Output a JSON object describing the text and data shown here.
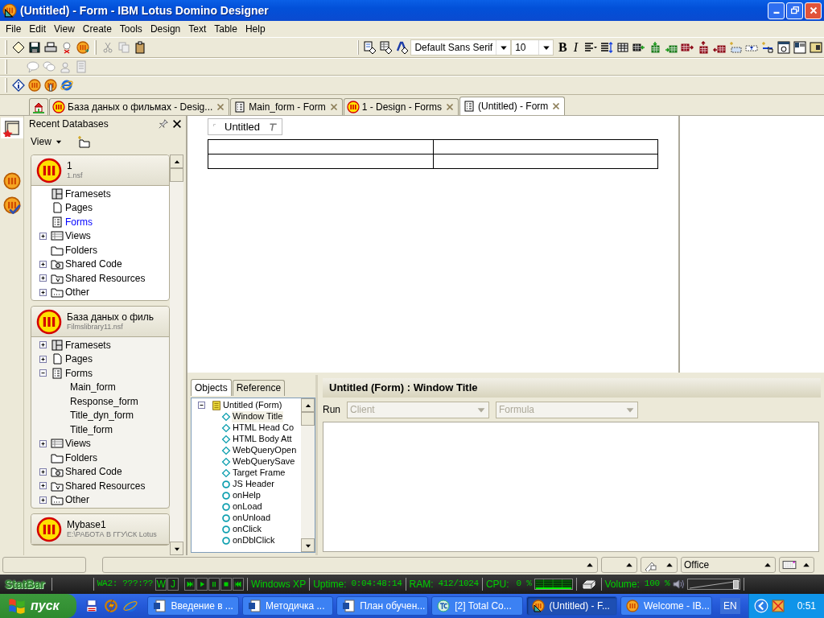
{
  "window": {
    "title": "(Untitled) - Form - IBM Lotus Domino Designer"
  },
  "menu": [
    "File",
    "Edit",
    "View",
    "Create",
    "Tools",
    "Design",
    "Text",
    "Table",
    "Help"
  ],
  "format_toolbar": {
    "font": "Default Sans Serif",
    "size": "10",
    "bold": "B",
    "italic": "I"
  },
  "tabs": [
    {
      "kind": "home",
      "selected": false
    },
    {
      "kind": "database",
      "label": "База даных о фильмах - Desig...",
      "selected": false
    },
    {
      "kind": "form",
      "label": "Main_form - Form",
      "selected": false
    },
    {
      "kind": "database",
      "label": "1 - Design - Forms",
      "selected": false
    },
    {
      "kind": "form",
      "label": "(Untitled) - Form",
      "selected": true
    }
  ],
  "sidebar": {
    "title": "Recent Databases",
    "view_menu": "View",
    "databases": [
      {
        "title": "1",
        "file": "1.nsf",
        "items": [
          {
            "kind": "frameset",
            "label": "Framesets",
            "selected": false
          },
          {
            "kind": "page",
            "label": "Pages",
            "selected": false
          },
          {
            "kind": "form",
            "label": "Forms",
            "selected": true
          },
          {
            "kind": "view",
            "label": "Views",
            "selected": false,
            "expanded": false
          },
          {
            "kind": "folder",
            "label": "Folders",
            "selected": false
          },
          {
            "kind": "shared-code",
            "label": "Shared Code",
            "selected": false,
            "expanded": false
          },
          {
            "kind": "shared-resources",
            "label": "Shared Resources",
            "selected": false,
            "expanded": false
          },
          {
            "kind": "other",
            "label": "Other",
            "selected": false,
            "expanded": false
          }
        ]
      },
      {
        "title": "База даных о филь",
        "file": "Filmslibrary11.nsf",
        "items": [
          {
            "kind": "frameset",
            "label": "Framesets",
            "selected": false,
            "expanded": false
          },
          {
            "kind": "page",
            "label": "Pages",
            "selected": false,
            "expanded": false
          },
          {
            "kind": "form",
            "label": "Forms",
            "selected": false,
            "expanded": true,
            "children": [
              {
                "label": "Main_form",
                "selected": false
              },
              {
                "label": "Response_form",
                "selected": false
              },
              {
                "label": "Title_dyn_form",
                "selected": false
              },
              {
                "label": "Title_form",
                "selected": false
              }
            ]
          },
          {
            "kind": "view",
            "label": "Views",
            "selected": false,
            "expanded": false
          },
          {
            "kind": "folder",
            "label": "Folders",
            "selected": false
          },
          {
            "kind": "shared-code",
            "label": "Shared Code",
            "selected": false,
            "expanded": false
          },
          {
            "kind": "shared-resources",
            "label": "Shared Resources",
            "selected": false,
            "expanded": false
          },
          {
            "kind": "other",
            "label": "Other",
            "selected": false,
            "expanded": false
          }
        ]
      },
      {
        "title": "Mybase1",
        "file": "E:\\РАБОТА В ГГУ\\СК Lotus"
      }
    ]
  },
  "form_canvas": {
    "title": "Untitled",
    "table": [
      {
        "cells": [
          {
            "kind": "empty"
          },
          {
            "kind": "empty"
          }
        ]
      },
      {
        "cells": [
          {
            "kind": "empty"
          },
          {
            "kind": "empty"
          }
        ]
      }
    ]
  },
  "objects_panel": {
    "tabs": [
      {
        "label": "Objects",
        "selected": true
      },
      {
        "label": "Reference",
        "selected": false
      }
    ],
    "tree": {
      "label": "Untitled (Form)",
      "expanded": true,
      "children": [
        {
          "kind": "event",
          "label": "Window Title",
          "selected": true
        },
        {
          "kind": "event",
          "label": "HTML Head Co",
          "selected": false
        },
        {
          "kind": "event",
          "label": "HTML Body Att",
          "selected": false
        },
        {
          "kind": "event",
          "label": "WebQueryOpen",
          "selected": false
        },
        {
          "kind": "event",
          "label": "WebQuerySave",
          "selected": false
        },
        {
          "kind": "event",
          "label": "Target Frame",
          "selected": false
        },
        {
          "kind": "script",
          "label": "JS Header",
          "selected": false
        },
        {
          "kind": "script",
          "label": "onHelp",
          "selected": false
        },
        {
          "kind": "script",
          "label": "onLoad",
          "selected": false
        },
        {
          "kind": "script",
          "label": "onUnload",
          "selected": false
        },
        {
          "kind": "script",
          "label": "onClick",
          "selected": false
        },
        {
          "kind": "script",
          "label": "onDblClick",
          "selected": false
        }
      ]
    }
  },
  "script_pane": {
    "title": "Untitled (Form) : Window Title",
    "run_label": "Run",
    "selects": [
      {
        "value": "Client",
        "disabled": true
      },
      {
        "value": "Formula",
        "disabled": true
      }
    ]
  },
  "status_bar": {
    "fields": [
      {
        "kind": "empty"
      },
      {
        "kind": "wide"
      },
      {
        "kind": "small"
      },
      {
        "kind": "icon"
      },
      {
        "kind": "text",
        "value": "Office"
      },
      {
        "kind": "keyboard"
      }
    ]
  },
  "statbar": {
    "logo": "StatBar",
    "winamp": "WA2: ???:??",
    "buttons": [
      "W",
      "J"
    ],
    "os": "Windows XP",
    "uptime_label": "Uptime:",
    "uptime": "0:04:48:14",
    "ram_label": "RAM:",
    "ram": "412/1024",
    "cpu_label": "CPU:",
    "cpu": "0 %",
    "volume_label": "Volume:",
    "volume": "100 %",
    "volume_slider": {
      "level": 0.92
    }
  },
  "taskbar": {
    "start": "пуск",
    "tasks": [
      {
        "kind": "word",
        "label": "Введение в ...",
        "selected": false
      },
      {
        "kind": "word",
        "label": "Методичка ...",
        "selected": false
      },
      {
        "kind": "word",
        "label": "План обучен...",
        "selected": false
      },
      {
        "kind": "commander",
        "label": "[2] Total Co...",
        "selected": false
      },
      {
        "kind": "designer",
        "label": "(Untitled) - F...",
        "selected": true
      },
      {
        "kind": "lotus",
        "label": "Welcome - IB...",
        "selected": false
      }
    ],
    "language": "EN",
    "clock": "0:51"
  }
}
